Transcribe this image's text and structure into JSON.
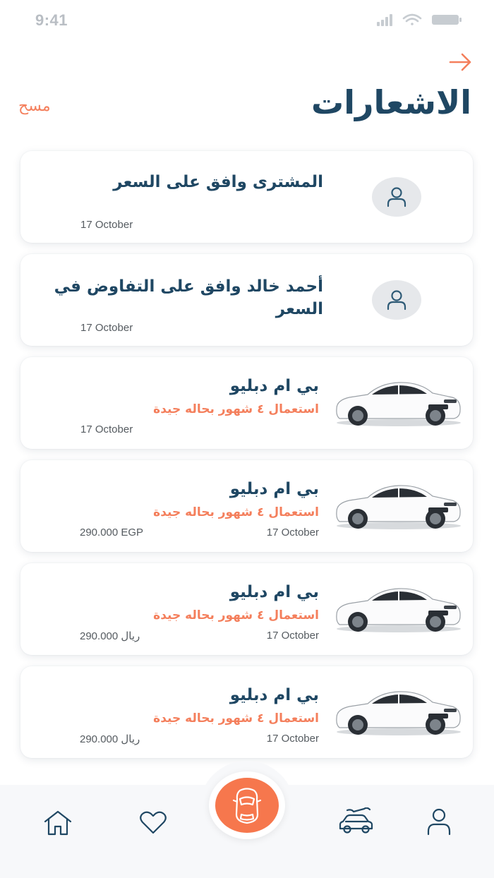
{
  "status_bar": {
    "time": "9:41"
  },
  "header": {
    "title": "الاشعارات",
    "clear_label": "مسح"
  },
  "notifications": [
    {
      "type": "user",
      "icon": "user-icon",
      "title": "المشترى وافق على السعر",
      "date": "17 October"
    },
    {
      "type": "user",
      "icon": "user-icon",
      "title": "أحمد خالد وافق على التفاوض في السعر",
      "date": "17 October"
    },
    {
      "type": "car",
      "title": "بي ام دبليو",
      "subtitle": "استعمال ٤ شهور بحاله جيدة",
      "date": "17 October"
    },
    {
      "type": "car",
      "title": "بي ام دبليو",
      "subtitle": "استعمال ٤ شهور بحاله جيدة",
      "date": "17 October",
      "price": "290.000 EGP"
    },
    {
      "type": "car",
      "title": "بي ام دبليو",
      "subtitle": "استعمال ٤ شهور بحاله جيدة",
      "date": "17 October",
      "price_value": "290.000",
      "price_currency": "ريال"
    },
    {
      "type": "car",
      "title": "بي ام دبليو",
      "subtitle": "استعمال ٤ شهور بحاله جيدة",
      "date": "17 October",
      "price_value": "290.000",
      "price_currency": "ريال"
    }
  ],
  "bottom_nav": {
    "items": [
      "home-icon",
      "heart-icon",
      "car-icon",
      "car-service-icon",
      "profile-icon"
    ],
    "active": "car-icon"
  },
  "colors": {
    "primary": "#1f4763",
    "accent": "#f47f5c",
    "center_button": "#f6774d"
  }
}
